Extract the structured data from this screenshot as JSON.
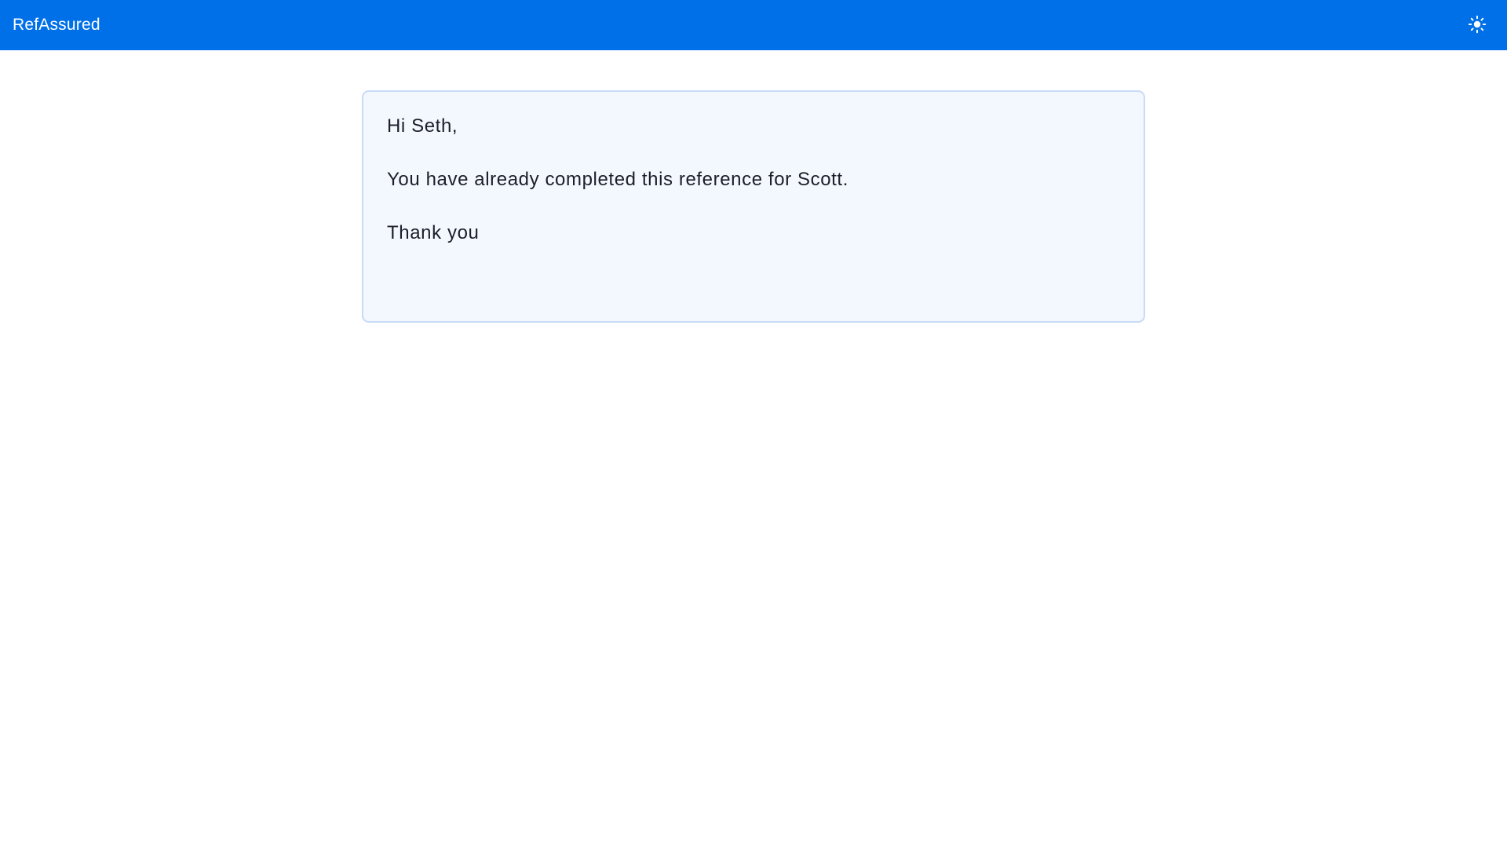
{
  "header": {
    "brand": "RefAssured",
    "theme_toggle_icon": "sun-icon",
    "background_color": "#0070e8"
  },
  "message": {
    "greeting": "Hi Seth,",
    "body": "You have already completed this reference for Scott.",
    "closing": "Thank you"
  },
  "colors": {
    "card_background": "#f3f7fe",
    "card_border": "#c9dbf7",
    "text": "#1c1f2a"
  }
}
